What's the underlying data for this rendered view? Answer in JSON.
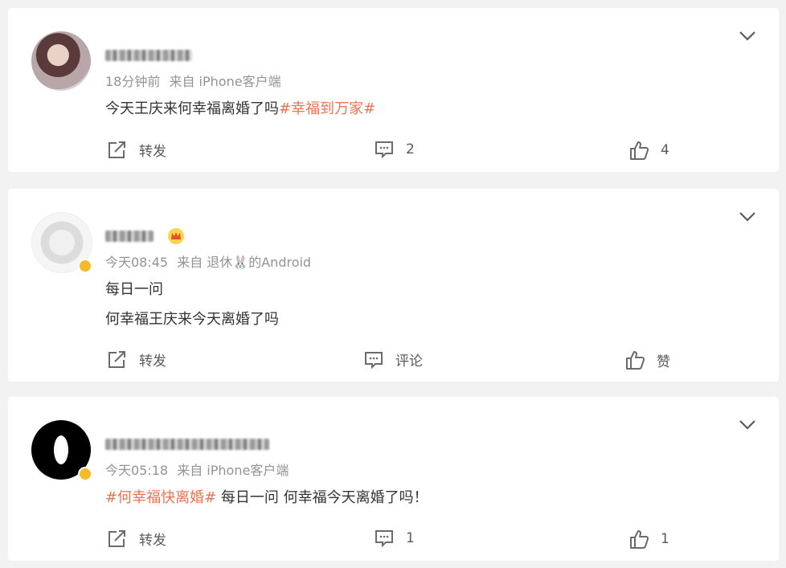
{
  "posts": [
    {
      "time": "18分钟前",
      "source": "来自 iPhone客户端",
      "lines": [
        {
          "text": "今天王庆来何幸福离婚了吗",
          "topic": "#幸福到万家#"
        }
      ],
      "actions": {
        "repost": "转发",
        "comment": "2",
        "like": "4"
      }
    },
    {
      "time": "今天08:45",
      "source": "来自 退休🐰的Android",
      "lines": [
        {
          "text": "每日一问",
          "topic": ""
        },
        {
          "text": "何幸福王庆来今天离婚了吗",
          "topic": ""
        }
      ],
      "actions": {
        "repost": "转发",
        "comment": "评论",
        "like": "赞"
      }
    },
    {
      "time": "今天05:18",
      "source": "来自 iPhone客户端",
      "lines": [
        {
          "topic": "#何幸福快离婚#",
          "text": " 每日一问 何幸福今天离婚了吗！"
        }
      ],
      "actions": {
        "repost": "转发",
        "comment": "1",
        "like": "1"
      }
    }
  ],
  "colors": {
    "topic": "#eb7350",
    "meta": "#939393",
    "badge": "#f6bb2a"
  }
}
